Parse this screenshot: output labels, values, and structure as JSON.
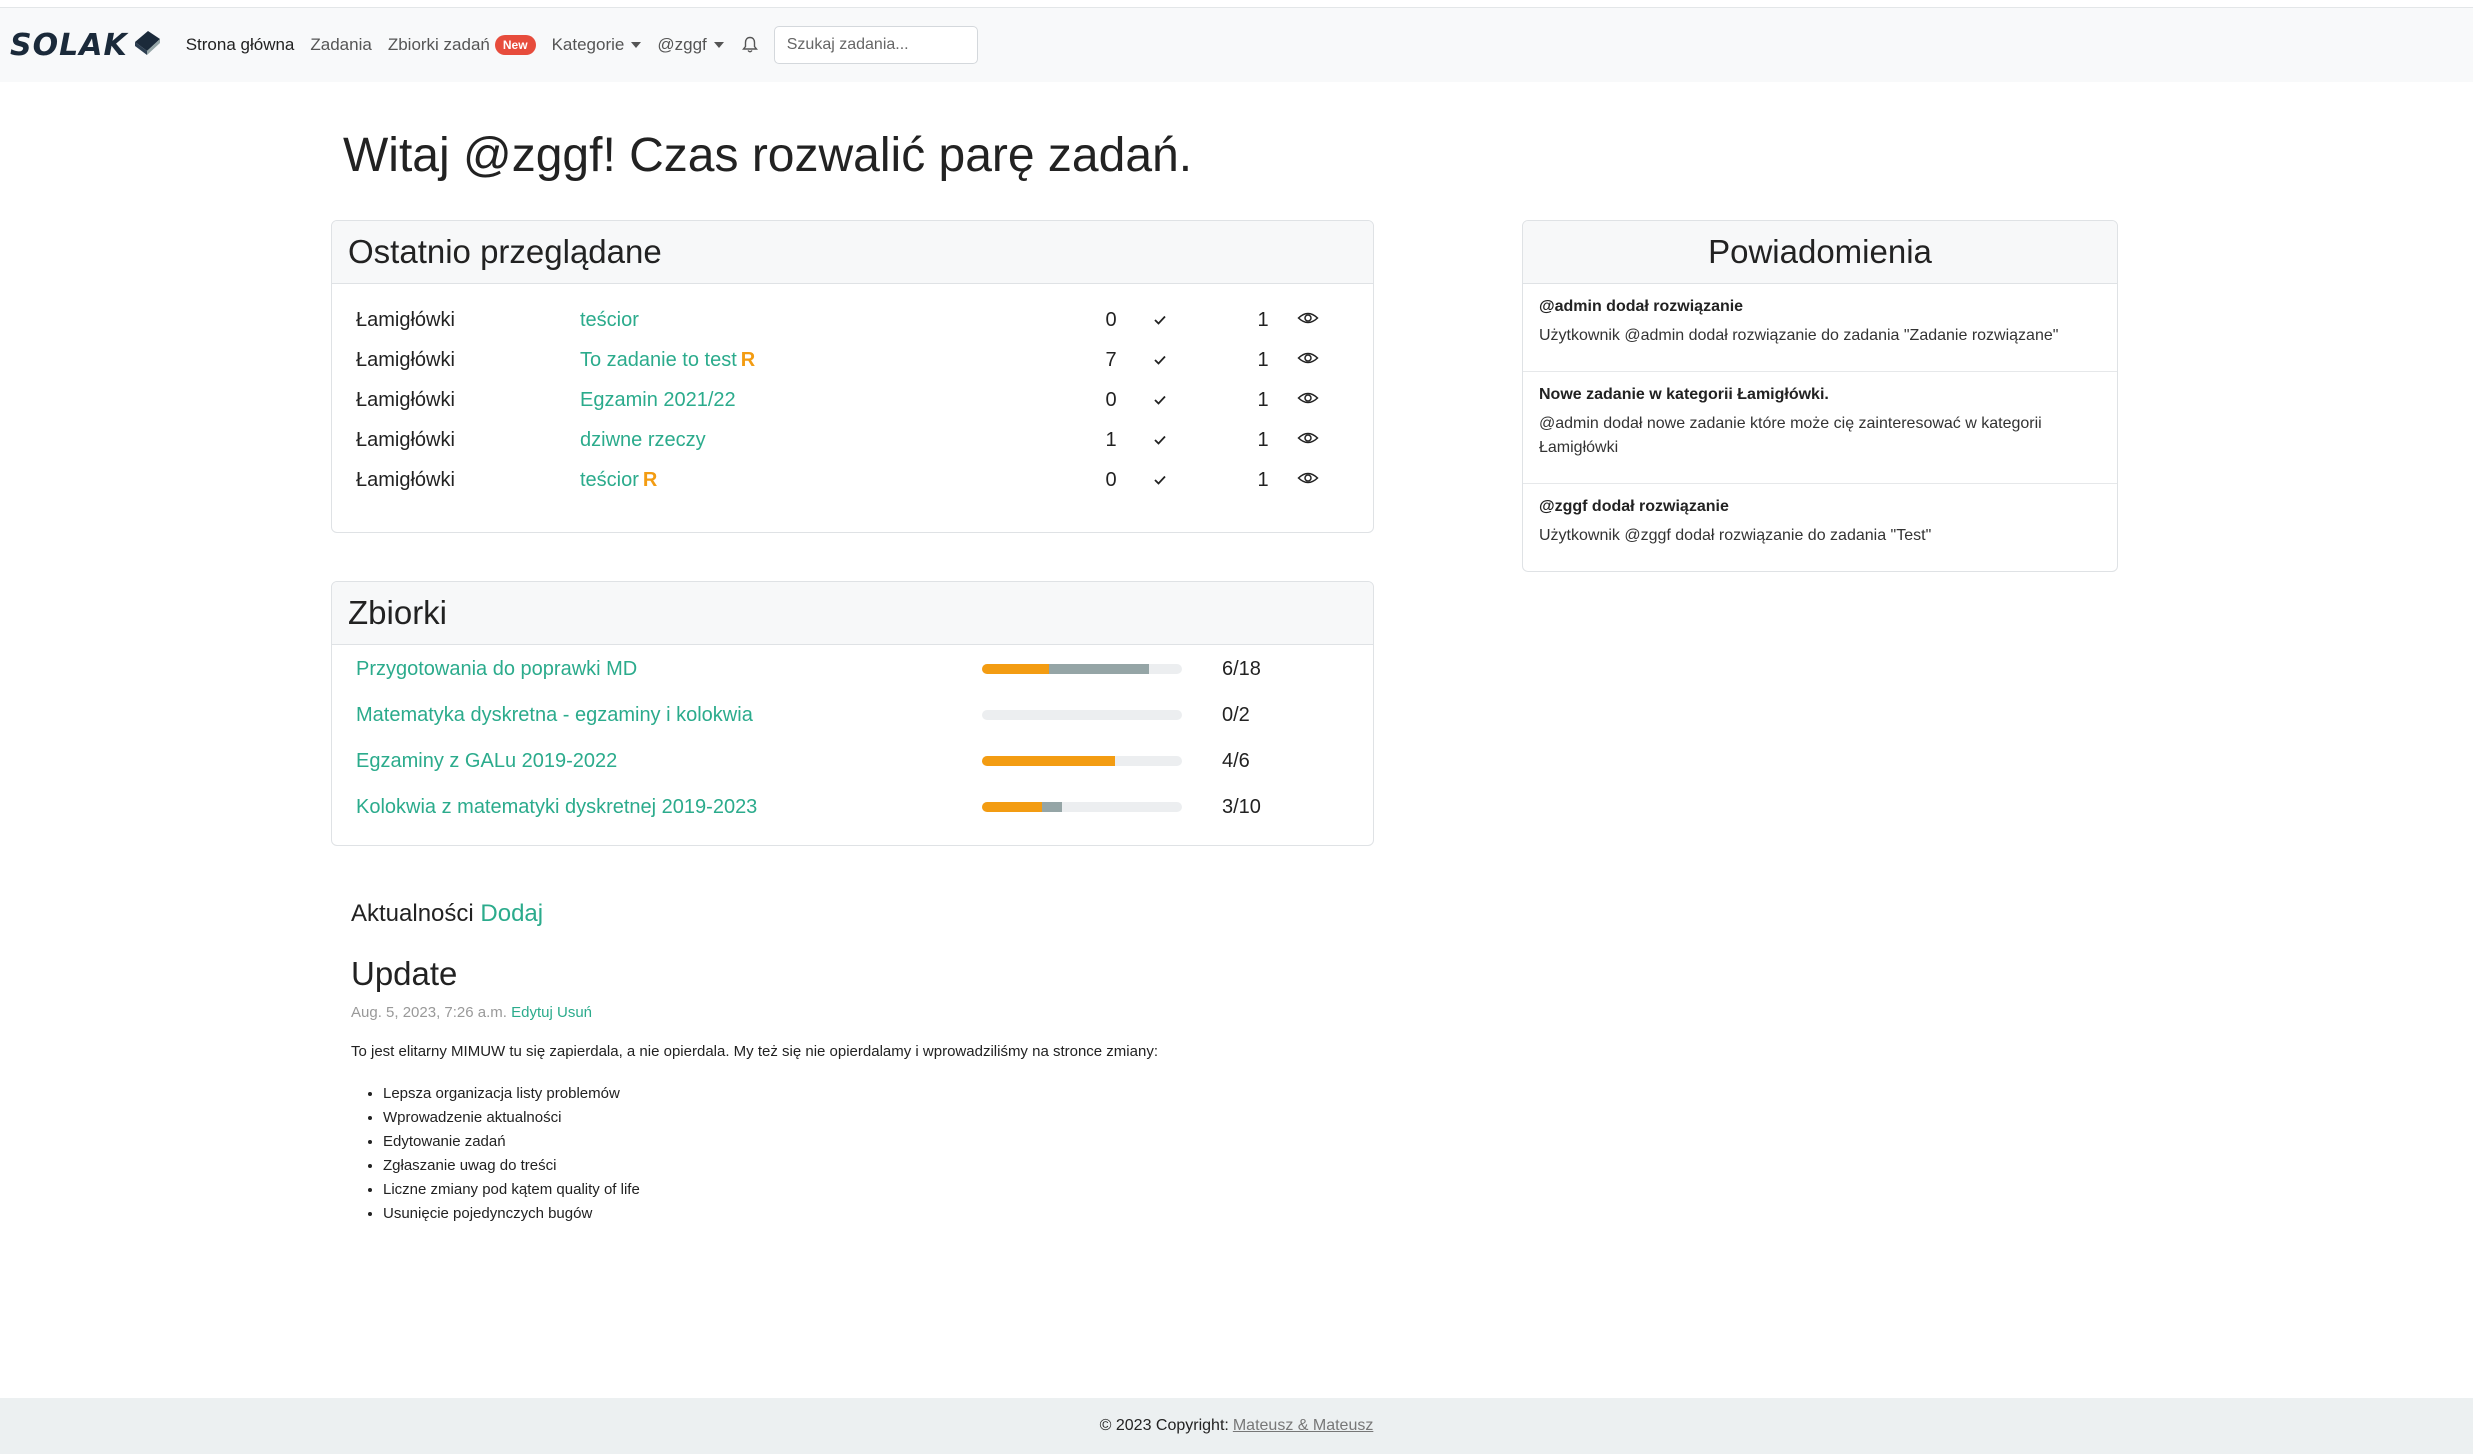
{
  "navbar": {
    "brand": "SOLAK",
    "items": [
      {
        "label": "Strona główna"
      },
      {
        "label": "Zadania"
      },
      {
        "label": "Zbiorki zadań"
      },
      {
        "label": "Kategorie"
      },
      {
        "label": "@zggf"
      }
    ],
    "new_badge": "New",
    "search_placeholder": "Szukaj zadania..."
  },
  "greeting": "Witaj @zggf! Czas rozwalić parę zadań.",
  "recent": {
    "header": "Ostatnio przeglądane",
    "rows": [
      {
        "category": "Łamigłówki",
        "title": "teścior",
        "r": "",
        "solved": "0",
        "views": "1"
      },
      {
        "category": "Łamigłówki",
        "title": "To zadanie to test",
        "r": "R",
        "solved": "7",
        "views": "1"
      },
      {
        "category": "Łamigłówki",
        "title": "Egzamin 2021/22",
        "r": "",
        "solved": "0",
        "views": "1"
      },
      {
        "category": "Łamigłówki",
        "title": "dziwne rzeczy",
        "r": "",
        "solved": "1",
        "views": "1"
      },
      {
        "category": "Łamigłówki",
        "title": "teścior",
        "r": "R",
        "solved": "0",
        "views": "1"
      }
    ]
  },
  "collections": {
    "header": "Zbiorki",
    "rows": [
      {
        "name": "Przygotowania do poprawki MD",
        "count": "6/18",
        "progress_orange": 0.333,
        "progress_gray": 0.5
      },
      {
        "name": "Matematyka dyskretna - egzaminy i kolokwia",
        "count": "0/2",
        "progress_orange": 0,
        "progress_gray": 0
      },
      {
        "name": "Egzaminy z GALu 2019-2022",
        "count": "4/6",
        "progress_orange": 0.667,
        "progress_gray": 0
      },
      {
        "name": "Kolokwia z matematyki dyskretnej 2019-2023",
        "count": "3/10",
        "progress_orange": 0.3,
        "progress_gray": 0.1
      }
    ]
  },
  "notifications": {
    "header": "Powiadomienia",
    "items": [
      {
        "title": "@admin dodał rozwiązanie",
        "body": "Użytkownik @admin dodał rozwiązanie do zadania \"Zadanie rozwiązane\""
      },
      {
        "title": "Nowe zadanie w kategorii Łamigłówki.",
        "body": "@admin dodał nowe zadanie które może cię zainteresować w kategorii Łamigłówki"
      },
      {
        "title": "@zggf dodał rozwiązanie",
        "body": "Użytkownik @zggf dodał rozwiązanie do zadania \"Test\""
      }
    ]
  },
  "news": {
    "label": "Aktualności",
    "add_link": "Dodaj",
    "post": {
      "title": "Update",
      "date": "Aug. 5, 2023, 7:26 a.m.",
      "edit": "Edytuj",
      "delete": "Usuń",
      "body": "To jest elitarny MIMUW tu się zapierdala, a nie opierdala. My też się nie opierdalamy i wprowadziliśmy na stronce zmiany:",
      "list": [
        "Lepsza organizacja listy problemów",
        "Wprowadzenie aktualności",
        "Edytowanie zadań",
        "Zgłaszanie uwag do treści",
        "Liczne zmiany pod kątem quality of life",
        "Usunięcie pojedynczych bugów"
      ]
    }
  },
  "footer": {
    "text": "© 2023 Copyright:",
    "link": "Mateusz & Mateusz"
  },
  "colors": {
    "accent": "#2bab8c",
    "orange": "#f39c12",
    "gray_progress": "#95a5a6",
    "badge": "#e74c3c"
  }
}
